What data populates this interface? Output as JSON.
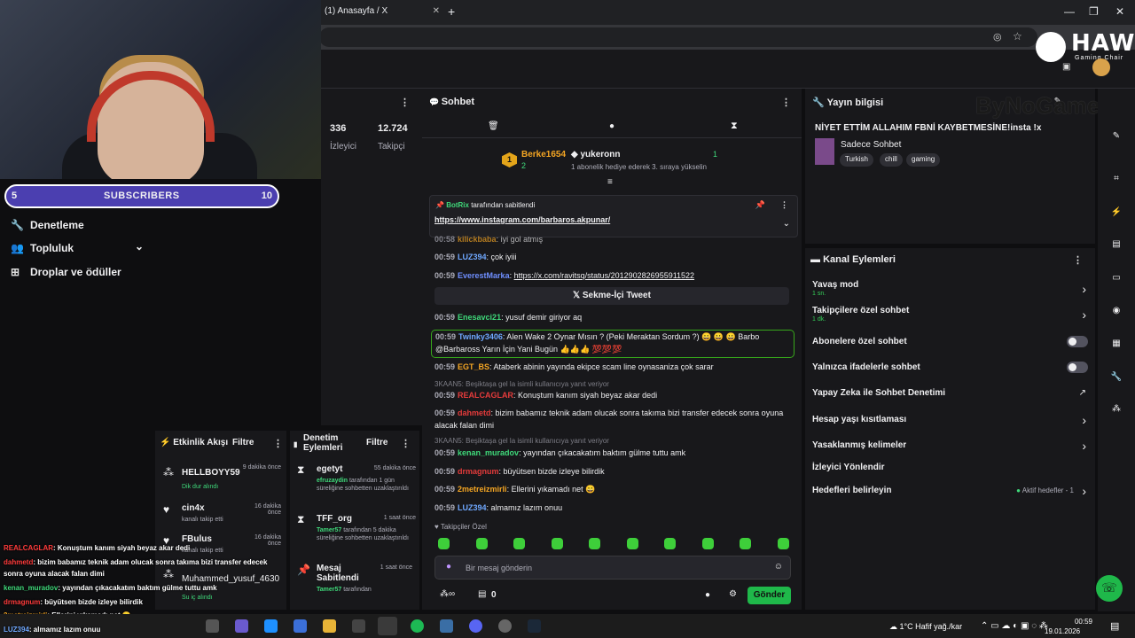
{
  "browser": {
    "tab_title": "(1) Anasayfa / X",
    "new_tab": "+",
    "win_controls": [
      "—",
      "❐",
      "✕"
    ]
  },
  "overlay": {
    "subs_current": "5",
    "subs_label": "SUBSCRIBERS",
    "subs_goal": "10",
    "brand": "HAWK",
    "brand_sub": "Gaming Chair",
    "sponsor": "ByNoGame"
  },
  "sidebar": {
    "items": [
      {
        "label": "Denetleme",
        "icon": "wrench-icon"
      },
      {
        "label": "Topluluk",
        "icon": "users-icon"
      },
      {
        "label": "Droplar ve ödüller",
        "icon": "gift-icon"
      }
    ]
  },
  "stats": {
    "viewers_value": "336",
    "viewers_label": "İzleyici",
    "followers_value": "12.724",
    "followers_label": "Takipçi"
  },
  "chat": {
    "title": "Sohbet",
    "gifter": {
      "name": "Berke1654",
      "count": "2",
      "rank": "1"
    },
    "gifter2": {
      "name": "yukeronn",
      "count": "1",
      "note": "1 abonelik hediye ederek 3. sıraya yükselin"
    },
    "pinned": {
      "by": "BotRix",
      "by_suffix": "tarafından sabitlendi",
      "link": "https://www.instagram.com/barbaros.akpunar/"
    },
    "messages": [
      {
        "time": "00:58",
        "user": "kilickbaba",
        "color": "#f5a623",
        "text": ": iyi gol atmış"
      },
      {
        "time": "00:59",
        "user": "LUZ394",
        "color": "#6fa8ff",
        "text": ": çok iyiii"
      },
      {
        "time": "00:59",
        "user": "EverestMarka",
        "color": "#6f8fff",
        "text": ": ",
        "link": "https://x.com/ravitsq/status/2012902826955911522"
      },
      {
        "time": "00:59",
        "user": "Enesavci21",
        "color": "#3fd97a",
        "text": ": yusuf demir giriyor aq"
      },
      {
        "time": "00:59",
        "user": "Twinky3406",
        "color": "#6fa8ff",
        "text": ": Alen Wake 2 Oynar Mısın ? (Peki Meraktan Sordum ?) 😀 😀 😀 Barbo"
      },
      {
        "time": "00:59",
        "user": "EGT_BS",
        "color": "#f5a623",
        "text": ": Ataberk abinin yayında ekipce scam line oynasaniza çok sarar"
      },
      {
        "time": "00:59",
        "user": "REALCAGLAR",
        "color": "#e53b3b",
        "text": ": Konuştum kanım siyah beyaz akar dedi"
      },
      {
        "time": "00:59",
        "user": "dahmetd",
        "color": "#e53b3b",
        "text": ": bizim babamız teknik adam olucak sonra takıma bizi transfer edecek sonra oyuna"
      },
      {
        "time": "00:59",
        "user": "kenan_muradov",
        "color": "#3fd97a",
        "text": ": yayından çıkacakatım baktım gülme tuttu amk"
      },
      {
        "time": "00:59",
        "user": "drmagnum",
        "color": "#e53b3b",
        "text": ": büyütsen bizde izleye bilirdik"
      },
      {
        "time": "00:59",
        "user": "2metreizmirli",
        "color": "#f5a623",
        "text": ": Ellerini yıkamadı net 😄"
      },
      {
        "time": "00:59",
        "user": "LUZ394",
        "color": "#6fa8ff",
        "text": ": almamız lazım onuu"
      }
    ],
    "wrap_text_twinky": "@Barbaross Yarın İçin Yani Bugün 👍👍👍 💯💯💯",
    "wrap_text_dahmetd": "alacak falan dimi",
    "reply_note_1": "3KAAN5: Beşiktaşa gel la isimli kullanıcıya yanıt veriyor",
    "reply_note_2": "3KAAN5: Beşiktaşa gel la isimli kullanıcıya yanıt veriyor",
    "tweet_button": "Sekme-İçi Tweet",
    "follower_only": "Takipçiler Özel",
    "input_placeholder": "Bir mesaj gönderin",
    "points": "0",
    "send": "Gönder"
  },
  "info": {
    "title": "Yayın bilgisi",
    "stream_title": "NİYET ETTİM ALLAHIM FBNİ KAYBETMESİNE!insta !x",
    "category": "Sadece Sohbet",
    "tags": [
      "Turkish",
      "chill",
      "gaming"
    ]
  },
  "actions": {
    "title": "Kanal Eylemleri",
    "items": [
      {
        "label": "Yavaş mod",
        "sub": "1 sn.",
        "ctrl": "chevron"
      },
      {
        "label": "Takipçilere özel sohbet",
        "sub": "1 dk.",
        "ctrl": "chevron"
      },
      {
        "label": "Abonelere özel sohbet",
        "sub": "",
        "ctrl": "toggle"
      },
      {
        "label": "Yalnızca ifadelerle sohbet",
        "sub": "",
        "ctrl": "toggle"
      },
      {
        "label": "Yapay Zeka ile Sohbet Denetimi",
        "sub": "",
        "ctrl": "external"
      },
      {
        "label": "Hesap yaşı kısıtlaması",
        "sub": "",
        "ctrl": "chevron"
      },
      {
        "label": "Yasaklanmış kelimeler",
        "sub": "",
        "ctrl": "chevron"
      },
      {
        "label": "İzleyici Yönlendir",
        "sub": "",
        "ctrl": "none"
      },
      {
        "label": "Hedefleri belirleyin",
        "sub": "",
        "ctrl": "chevron",
        "status": "Aktif hedefler - 1"
      }
    ]
  },
  "feed": {
    "title": "Etkinlik Akışı",
    "filter": "Filtre",
    "items": [
      {
        "name": "HELLBOYY59",
        "sub": "Dik dur alındı",
        "time": "9 dakika önce",
        "icon": "gift-icon"
      },
      {
        "name": "cin4x",
        "sub": "kanalı takip etti",
        "time": "16 dakika önce",
        "icon": "heart-icon"
      },
      {
        "name": "FBulus",
        "sub": "kanalı takip etti",
        "time": "16 dakika önce",
        "icon": "heart-icon"
      },
      {
        "name": "Muhammed_yusuf_4630",
        "sub": "Su iç alındı",
        "time": "",
        "icon": "gift-icon"
      }
    ]
  },
  "audit": {
    "title": "Denetim Eylemleri",
    "filter": "Filtre",
    "items": [
      {
        "name": "egetyt",
        "time": "55 dakika önce",
        "by": "efruzaydin",
        "text": "tarafından 1 gün süreliğine sohbetten uzaklaştırıldı",
        "icon": "hourglass-icon"
      },
      {
        "name": "TFF_org",
        "time": "1 saat önce",
        "by": "Tamer57",
        "text": "tarafından 5 dakika süreliğine sohbetten uzaklaştırıldı",
        "icon": "hourglass-icon"
      },
      {
        "name": "Mesaj Sabitlendi",
        "time": "1 saat önce",
        "by": "Tamer57",
        "text": "tarafından",
        "icon": "pin-icon"
      }
    ]
  },
  "overlay_chat": [
    {
      "user": "REALCAGLAR",
      "color": "#ff3b3b",
      "text": ": Konuştum kanım siyah beyaz akar dedi"
    },
    {
      "user": "dahmetd",
      "color": "#ff3b3b",
      "text": ": bizim babamız teknik adam olucak sonra takıma bizi transfer edecek"
    },
    {
      "user": "",
      "color": "#fff",
      "text": "sonra oyuna alacak falan dimi"
    },
    {
      "user": "kenan_muradov",
      "color": "#3fd97a",
      "text": ": yayından çıkacakatım baktım gülme tuttu amk"
    },
    {
      "user": "drmagnum",
      "color": "#ff3b3b",
      "text": ": büyütsen bizde izleye bilirdik"
    },
    {
      "user": "2metreizmirli",
      "color": "#f5a623",
      "text": ": Ellerini yıkamadı net 😄"
    },
    {
      "user": "LUZ394",
      "color": "#6fa8ff",
      "text": ": almamız lazım onuu"
    }
  ],
  "taskbar": {
    "weather": "1°C  Hafif yağ./kar",
    "time": "00:59",
    "date": "19.01.2026"
  }
}
